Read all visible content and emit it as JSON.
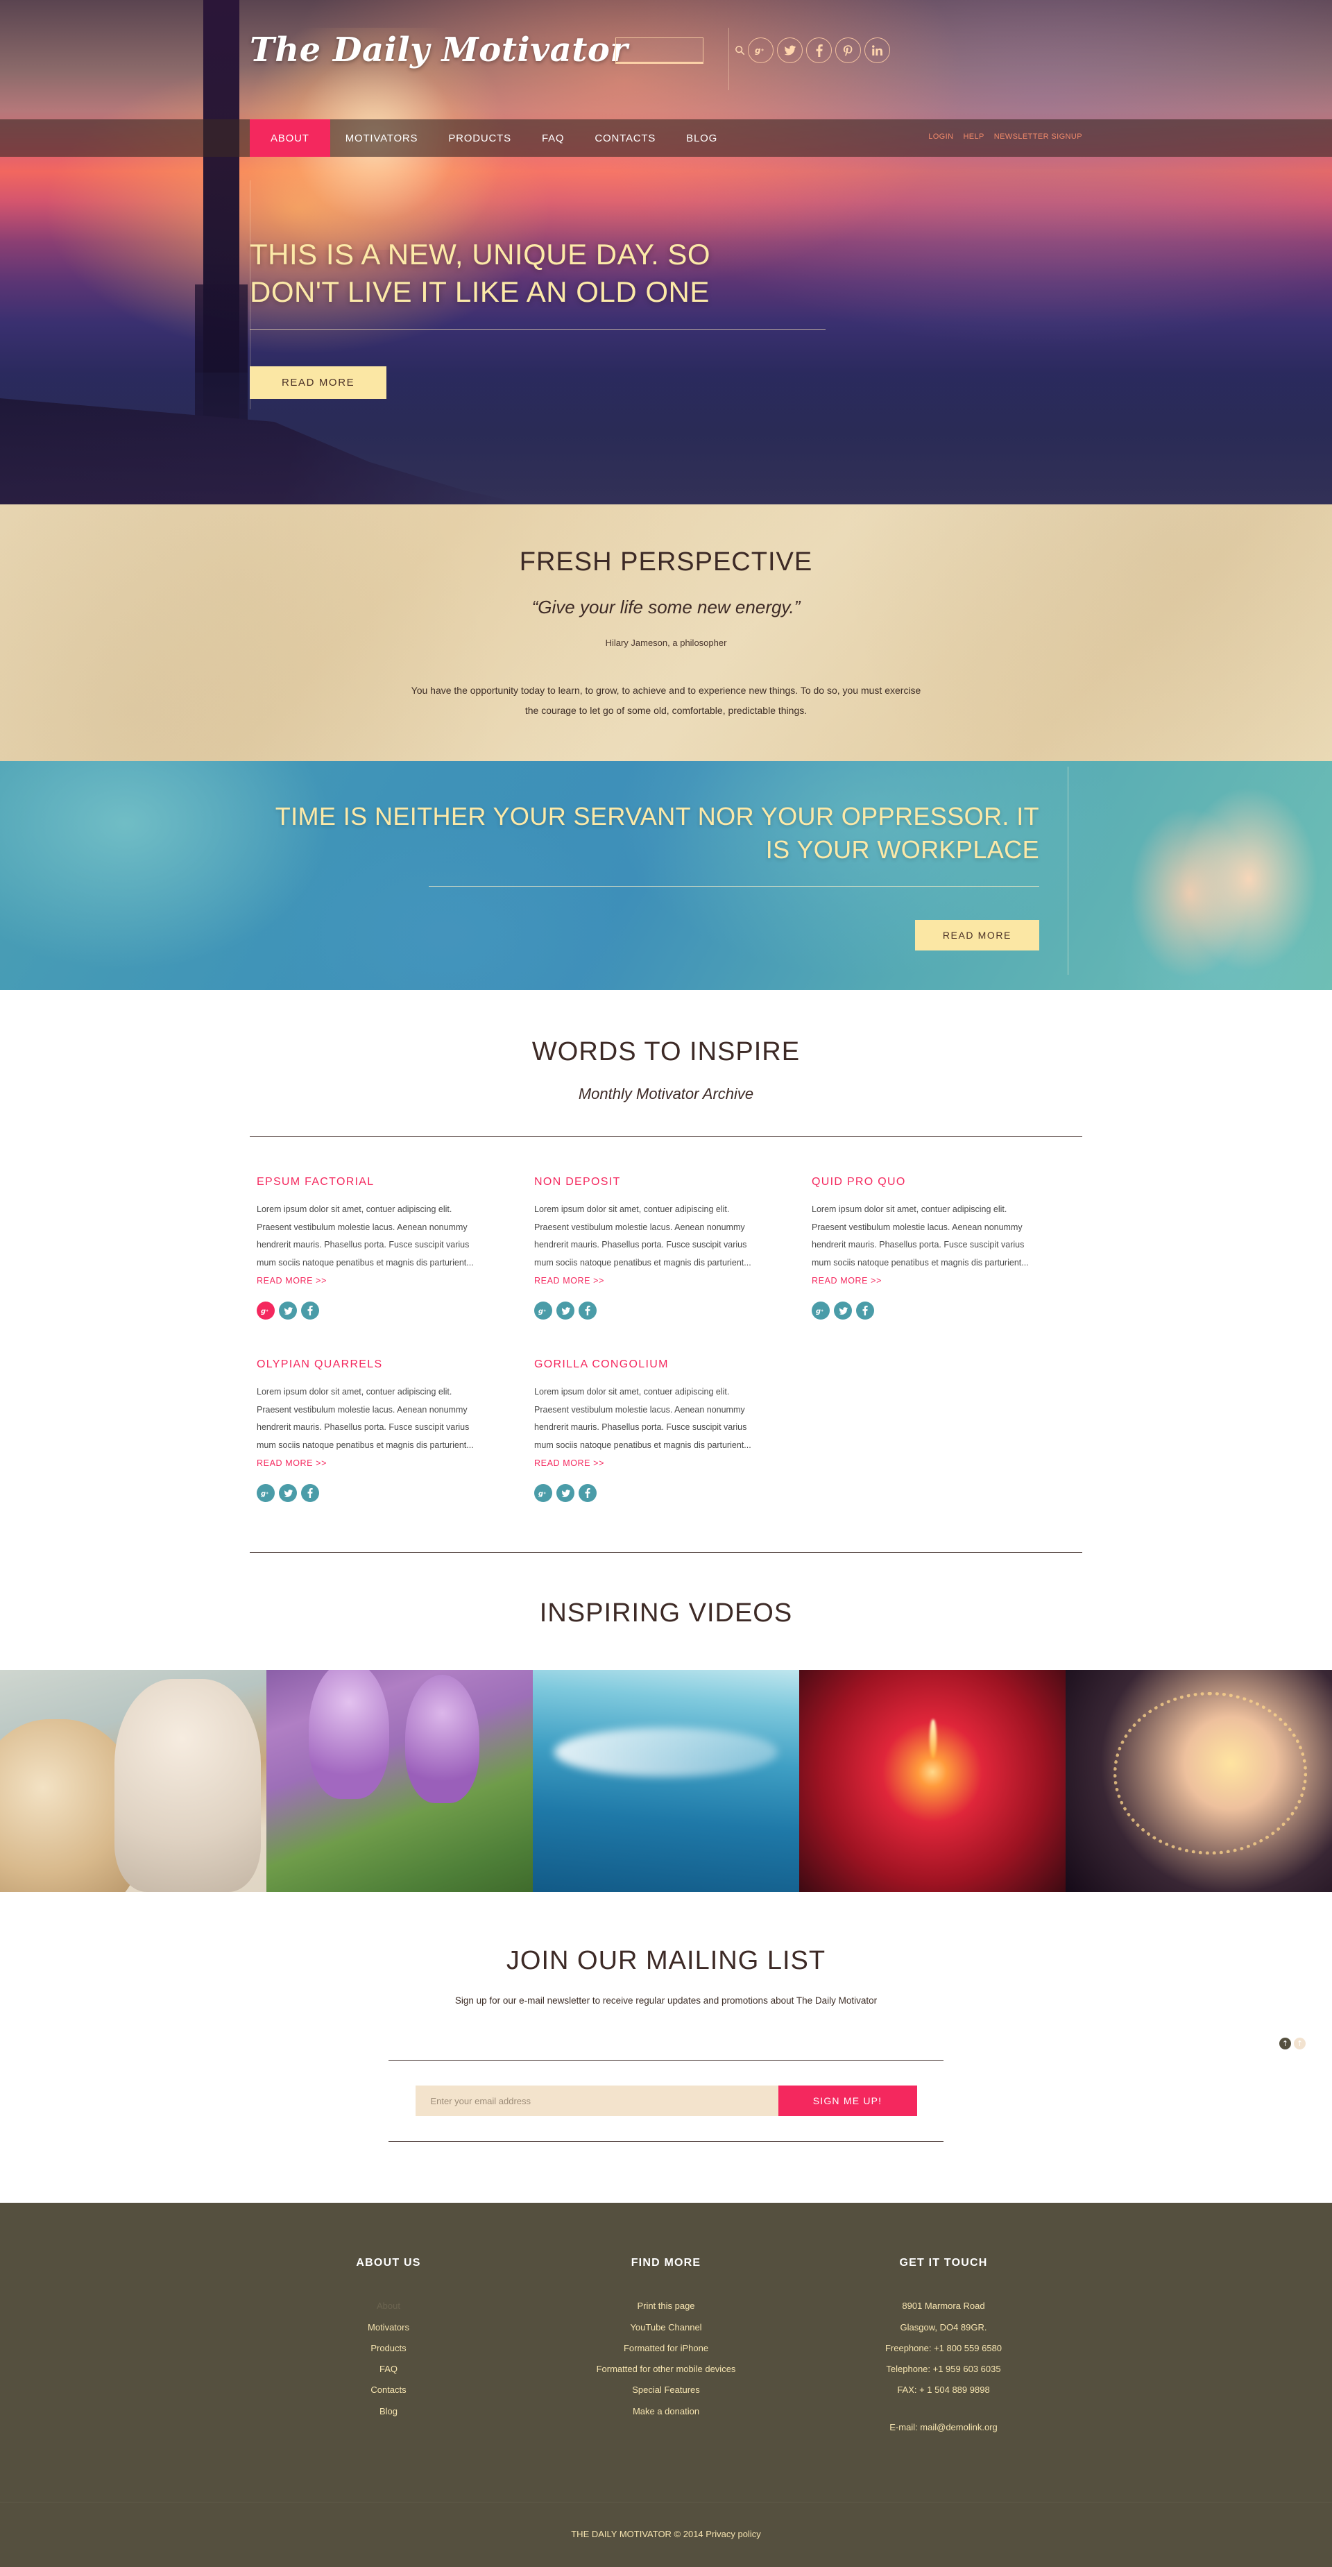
{
  "site": {
    "brand": "The Daily Motivator"
  },
  "search": {
    "placeholder": "",
    "value": "",
    "icon": "search-icon"
  },
  "social_top": [
    {
      "name": "google-plus-icon",
      "glyph": "g+"
    },
    {
      "name": "twitter-icon",
      "glyph": "t"
    },
    {
      "name": "facebook-icon",
      "glyph": "f"
    },
    {
      "name": "pinterest-icon",
      "glyph": "p"
    },
    {
      "name": "linkedin-icon",
      "glyph": "in"
    }
  ],
  "nav": {
    "items": [
      {
        "label": "ABOUT",
        "active": true
      },
      {
        "label": "MOTIVATORS",
        "active": false
      },
      {
        "label": "PRODUCTS",
        "active": false
      },
      {
        "label": "FAQ",
        "active": false
      },
      {
        "label": "CONTACTS",
        "active": false
      },
      {
        "label": "BLOG",
        "active": false
      }
    ],
    "utility": [
      {
        "label": "LOGIN"
      },
      {
        "label": "HELP"
      },
      {
        "label": "NEWSLETTER SIGNUP"
      }
    ]
  },
  "hero": {
    "title": "THIS IS A NEW, UNIQUE DAY. SO DON'T LIVE IT LIKE AN OLD ONE",
    "button": "READ MORE"
  },
  "fresh": {
    "title": "FRESH PERSPECTIVE",
    "quote": "“Give your life some new energy.”",
    "author": "Hilary Jameson, a philosopher",
    "body": "You have the opportunity today to learn, to grow, to achieve and to experience new things. To do so, you must exercise the courage to let go of some old, comfortable, predictable things."
  },
  "teal": {
    "title": "TIME IS NEITHER YOUR SERVANT NOR YOUR OPPRESSOR. IT IS YOUR WORKPLACE",
    "button": "READ MORE"
  },
  "inspire": {
    "title": "WORDS TO INSPIRE",
    "subtitle": "Monthly Motivator Archive",
    "read_more": "READ MORE >>",
    "body_text": "Lorem ipsum dolor sit amet, contuer adipiscing elit. Praesent vestibulum molestie lacus. Aenean nonummy hendrerit mauris. Phasellus porta. Fusce suscipit varius mum sociis natoque penatibus et magnis dis parturient...",
    "cards": [
      {
        "title": "EPSUM FACTORIAL",
        "gplus_highlight": true
      },
      {
        "title": "NON DEPOSIT",
        "gplus_highlight": false
      },
      {
        "title": "QUID PRO QUO",
        "gplus_highlight": false
      },
      {
        "title": "OLYPIAN QUARRELS",
        "gplus_highlight": false
      },
      {
        "title": "GORILLA CONGOLIUM",
        "gplus_highlight": false
      }
    ],
    "card_socials": [
      {
        "name": "google-plus-icon",
        "glyph": "g+"
      },
      {
        "name": "twitter-icon",
        "glyph": "t"
      },
      {
        "name": "facebook-icon",
        "glyph": "f"
      }
    ]
  },
  "videos": {
    "title": "INSPIRING VIDEOS",
    "items": [
      {
        "name": "video-couple-beach",
        "has_play": true
      },
      {
        "name": "video-purple-crocus",
        "has_play": false
      },
      {
        "name": "video-ocean-wave",
        "has_play": false
      },
      {
        "name": "video-red-candle",
        "has_play": false
      },
      {
        "name": "video-night-fair",
        "has_play": false
      }
    ]
  },
  "mailing": {
    "title": "JOIN OUR MAILING LIST",
    "subtitle": "Sign up for our e-mail newsletter to receive regular updates and promotions about The Daily Motivator",
    "input_placeholder": "Enter your email address",
    "input_value": "",
    "button": "SIGN ME UP!"
  },
  "scroll_top": {
    "dark": "↑",
    "light": "↑"
  },
  "footer": {
    "about": {
      "heading": "ABOUT US",
      "items": [
        {
          "label": "About",
          "active": true
        },
        {
          "label": "Motivators",
          "active": false
        },
        {
          "label": "Products",
          "active": false
        },
        {
          "label": "FAQ",
          "active": false
        },
        {
          "label": "Contacts",
          "active": false
        },
        {
          "label": "Blog",
          "active": false
        }
      ]
    },
    "find": {
      "heading": "FIND MORE",
      "items": [
        {
          "label": "Print this page"
        },
        {
          "label": "YouTube Channel"
        },
        {
          "label": "Formatted for iPhone"
        },
        {
          "label": "Formatted for other mobile devices"
        },
        {
          "label": "Special Features"
        },
        {
          "label": "Make a donation"
        }
      ]
    },
    "contact": {
      "heading": "GET IT TOUCH",
      "lines": [
        "8901 Marmora Road",
        "Glasgow, DO4 89GR.",
        "Freephone:  +1 800 559 6580",
        "Telephone:   +1 959 603 6035",
        "FAX:           + 1 504 889 9898"
      ],
      "email": "E-mail: mail@demolink.org"
    },
    "copyright": "THE DAILY MOTIVATOR © 2014 Privacy policy"
  },
  "colors": {
    "accent_pink": "#f4285e",
    "cream": "#fbe7a4",
    "dark_brown": "#3d2a26",
    "teal_social": "#4a9ca8",
    "footer_bg": "#55503f"
  }
}
